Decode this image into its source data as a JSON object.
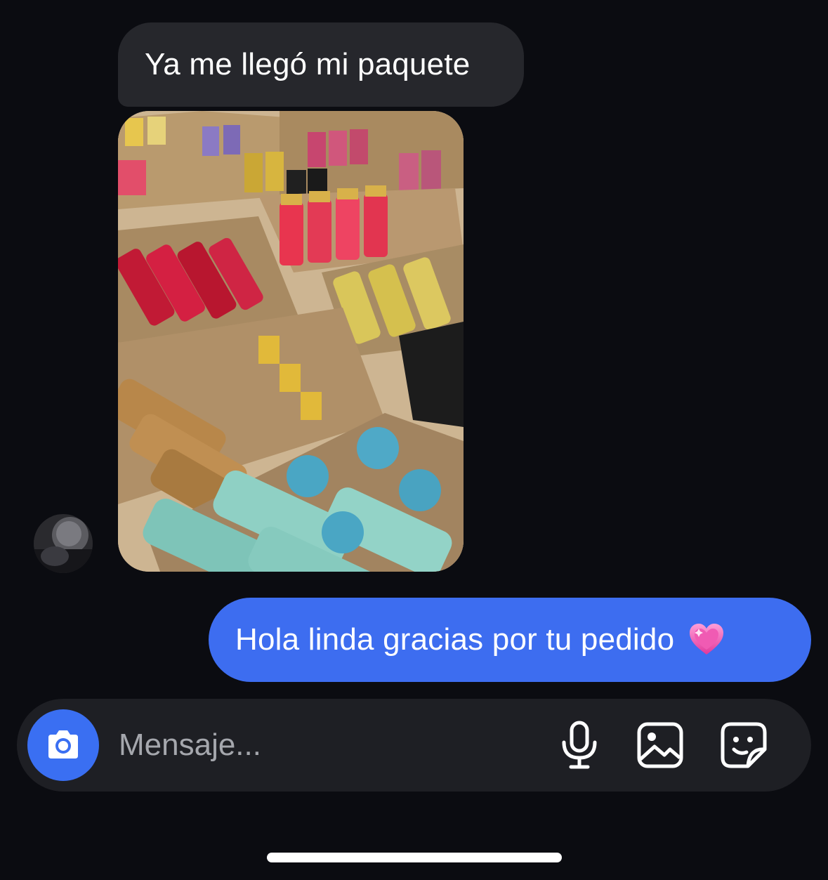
{
  "thread": {
    "incoming_text": "Ya me llegó mi paquete",
    "outgoing_text": "Hola linda gracias por tu  pedido",
    "outgoing_emoji": "sparkling-heart-emoji"
  },
  "composer": {
    "placeholder": "Mensaje...",
    "icons": [
      "camera-icon",
      "microphone-icon",
      "gallery-icon",
      "sticker-icon"
    ]
  },
  "colors": {
    "background": "#0b0c11",
    "incoming_bubble": "#26272c",
    "outgoing_bubble": "#3d6df0",
    "composer": "#1e1f24",
    "camera_button": "#3a6ff2",
    "placeholder": "#a5a7ad"
  }
}
